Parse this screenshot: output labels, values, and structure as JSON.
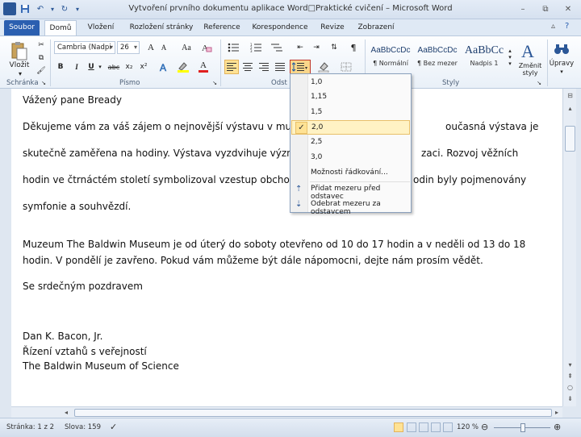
{
  "window": {
    "title": "Vytvoření prvního dokumentu aplikace Word□Praktické cvičení – Microsoft Word",
    "minimize": "–",
    "restore": "⧉",
    "close": "✕"
  },
  "qat": {
    "app_icon": "W",
    "save_icon": "save-icon",
    "undo_icon": "undo-icon",
    "redo_icon": "redo-icon"
  },
  "tabs": [
    {
      "label": "Soubor"
    },
    {
      "label": "Domů"
    },
    {
      "label": "Vložení"
    },
    {
      "label": "Rozložení stránky"
    },
    {
      "label": "Reference"
    },
    {
      "label": "Korespondence"
    },
    {
      "label": "Revize"
    },
    {
      "label": "Zobrazení"
    }
  ],
  "ribbon": {
    "clipboard": {
      "label": "Schránka",
      "paste": "Vložit"
    },
    "font": {
      "label": "Písmo",
      "font_name": "Cambria (Nadpi",
      "font_size": "26",
      "bold": "B",
      "italic": "I",
      "underline": "U",
      "strike": "abc",
      "subscript": "x₂",
      "superscript": "x²",
      "grow": "A",
      "shrink": "A",
      "case": "Aa",
      "font_color": "A"
    },
    "paragraph": {
      "label": "Odst"
    },
    "styles": {
      "label": "Styly",
      "items": [
        {
          "sample": "AaBbCcDc",
          "name": "¶ Normální"
        },
        {
          "sample": "AaBbCcDc",
          "name": "¶ Bez mezer"
        },
        {
          "sample": "AaBbCc",
          "name": "Nadpis 1"
        }
      ],
      "change_styles": "Změnit styly"
    },
    "editing": {
      "label": "Úpravy"
    }
  },
  "line_spacing_menu": {
    "options": [
      "1,0",
      "1,15",
      "1,5",
      "2,0",
      "2,5",
      "3,0"
    ],
    "selected": "2,0",
    "more": "Možnosti řádkování...",
    "add_before": "Přidat mezeru před odstavec",
    "remove_after": "Odebrat mezeru za odstavcem"
  },
  "document": {
    "lines": [
      "Vážený pane Bready",
      "Děkujeme vám za váš zájem o nejnovější výstavu v muzeu T",
      "oučasná výstava je",
      "skutečně zaměřena na hodiny. Výstava vyzdvihuje význam č",
      "zaci. Rozvoj věžních",
      "hodin ve čtrnáctém století symbolizoval vzestup obchodníh",
      "odin byly pojmenovány",
      "symfonie a souhvězdí.",
      "Muzeum The Baldwin Museum je od úterý do soboty otevřeno od 10 do 17 hodin a v neděli od 13 do 18",
      "hodin. V pondělí je zavřeno. Pokud vám můžeme být dále nápomocni, dejte nám prosím vědět.",
      "Se srdečným pozdravem",
      "Dan K. Bacon, Jr.",
      "Řízení vztahů s veřejností",
      "The Baldwin Museum of Science"
    ]
  },
  "status": {
    "page": "Stránka: 1 z 2",
    "words": "Slova: 159",
    "zoom": "120 %"
  }
}
